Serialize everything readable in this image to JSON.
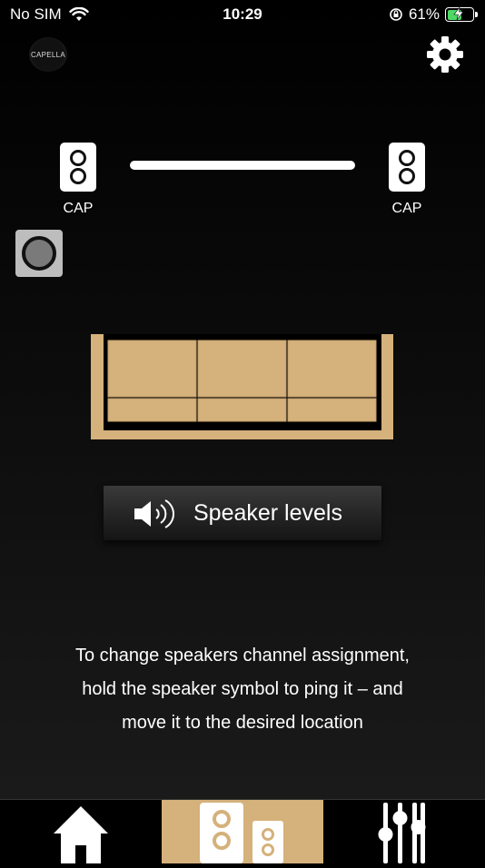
{
  "status_bar": {
    "carrier": "No SIM",
    "time": "10:29",
    "battery": "61%",
    "battery_level": 0.61
  },
  "logo": {
    "text": "CAPELLA"
  },
  "speakers": {
    "left_label": "CAP",
    "right_label": "CAP"
  },
  "levels_button": {
    "label": "Speaker levels"
  },
  "help_text": {
    "line1": "To change speakers channel assignment,",
    "line2": "hold the speaker symbol to ping it – and",
    "line3": "move it to the desired location"
  },
  "tabs": [
    {
      "name": "home",
      "icon": "house-icon",
      "active": false
    },
    {
      "name": "speakers",
      "icon": "speakers-icon",
      "active": true
    },
    {
      "name": "equalizer",
      "icon": "sliders-icon",
      "active": false
    }
  ],
  "colors": {
    "accent": "#d5b17b",
    "battery": "#4cd964",
    "background": "#000000"
  }
}
